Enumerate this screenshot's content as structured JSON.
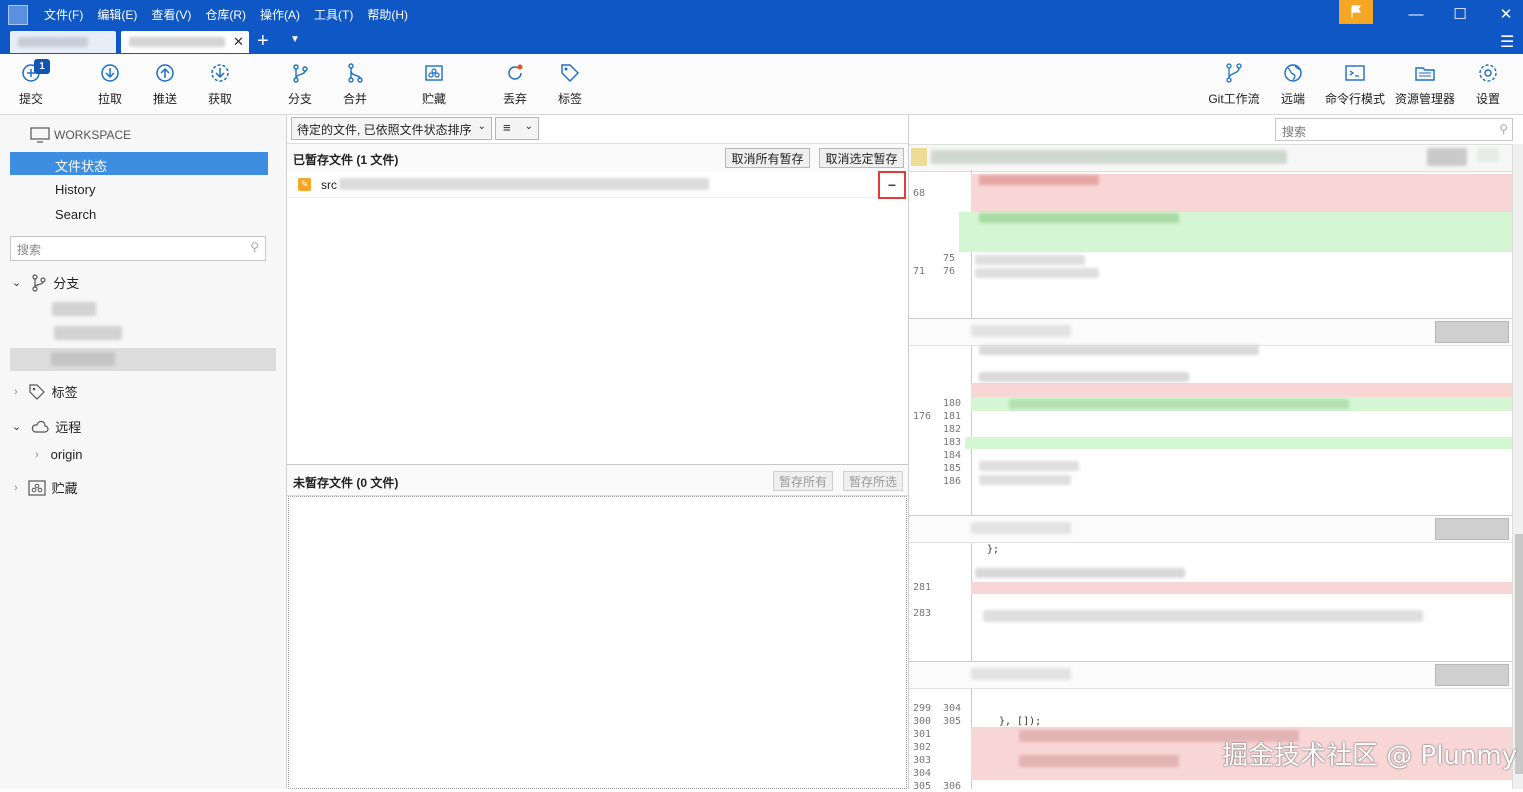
{
  "menu": [
    "文件(F)",
    "编辑(E)",
    "查看(V)",
    "仓库(R)",
    "操作(A)",
    "工具(T)",
    "帮助(H)"
  ],
  "toolbar": {
    "commit": "提交",
    "commit_badge": "1",
    "pull": "拉取",
    "push": "推送",
    "fetch": "获取",
    "branch": "分支",
    "merge": "合并",
    "stash": "贮藏",
    "discard": "丢弃",
    "tag": "标签",
    "git_flow": "Git工作流",
    "remote": "远端",
    "terminal": "命令行模式",
    "explorer": "资源管理器",
    "settings": "设置"
  },
  "sidebar": {
    "workspace": "WORKSPACE",
    "file_status": "文件状态",
    "history": "History",
    "search": "Search",
    "search_placeholder": "搜索",
    "branches": "分支",
    "tags": "标签",
    "remotes": "远程",
    "origin": "origin",
    "stashes": "贮藏"
  },
  "middle": {
    "sort_select": "待定的文件, 已依照文件状态排序",
    "view_icon": "≡",
    "staged_title": "已暂存文件  (1 文件)",
    "unstage_all": "取消所有暂存",
    "unstage_selected": "取消选定暂存",
    "staged_file_prefix": "src",
    "unstaged_title": "未暂存文件  (0 文件)",
    "stage_all": "暂存所有",
    "stage_selected": "暂存所选"
  },
  "right": {
    "search_placeholder": "搜索",
    "line_numbers_1": [
      "68",
      "75",
      "76"
    ],
    "line_numbers_1_old": [
      "71"
    ],
    "line_numbers_2_new": [
      "180",
      "181",
      "182",
      "183",
      "184",
      "185",
      "186"
    ],
    "line_numbers_2_old": [
      "176"
    ],
    "line_numbers_3": [
      "281",
      "283"
    ],
    "line_numbers_4_old": [
      "299",
      "300",
      "301",
      "302",
      "303",
      "304",
      "305"
    ],
    "line_numbers_4_new": [
      "304",
      "305",
      "306"
    ],
    "code_snippets": [
      "};",
      "}, []);",
      "..."
    ]
  },
  "watermark": "掘金技术社区 @ Plunmy"
}
